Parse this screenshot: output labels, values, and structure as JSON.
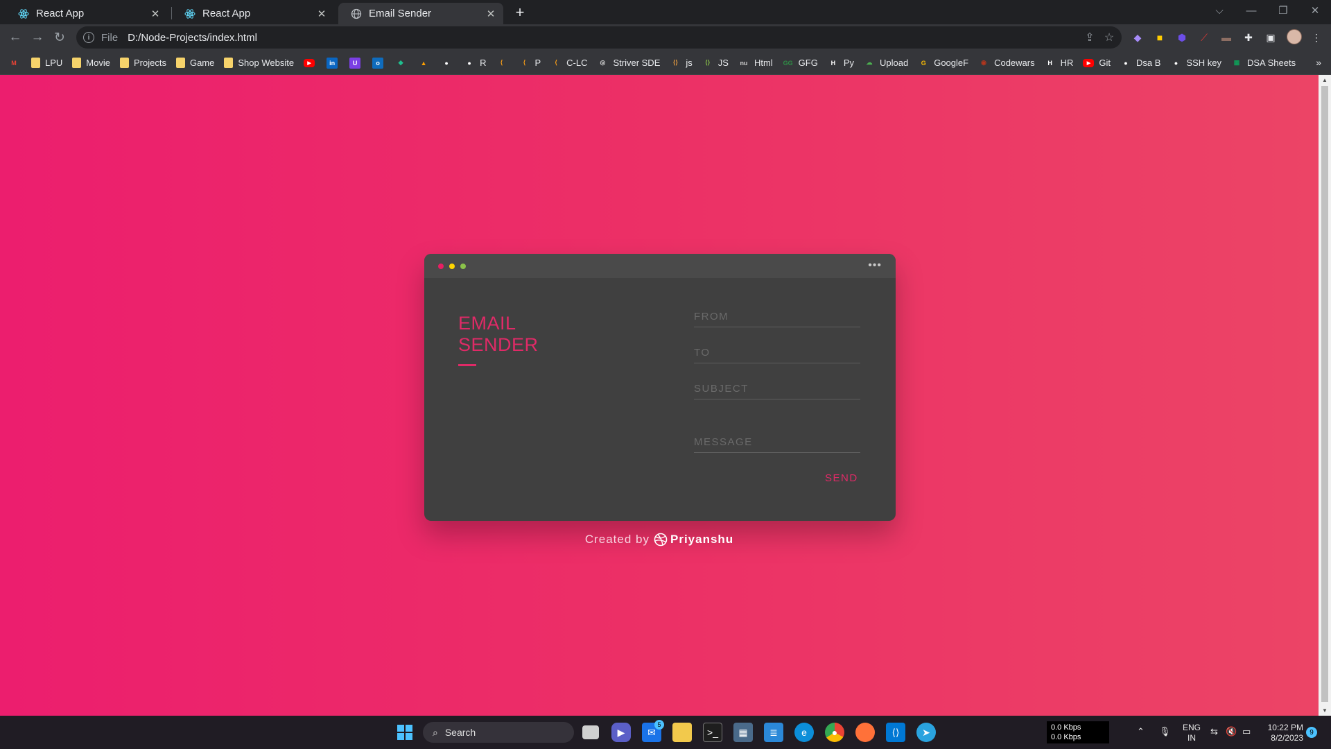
{
  "browser": {
    "tabs": [
      {
        "title": "React App",
        "active": false,
        "icon": "react-icon"
      },
      {
        "title": "React App",
        "active": false,
        "icon": "react-icon"
      },
      {
        "title": "Email Sender",
        "active": true,
        "icon": "globe-icon"
      }
    ],
    "address": {
      "scheme": "File",
      "url": "D:/Node-Projects/index.html"
    },
    "bookmarks": [
      {
        "label": "",
        "icon": "gmail-icon",
        "color": "#ea4335"
      },
      {
        "label": "LPU",
        "icon": "folder-icon",
        "color": "#f6d36b"
      },
      {
        "label": "Movie",
        "icon": "folder-icon",
        "color": "#f6d36b"
      },
      {
        "label": "Projects",
        "icon": "folder-icon",
        "color": "#f6d36b"
      },
      {
        "label": "Game",
        "icon": "folder-icon",
        "color": "#f6d36b"
      },
      {
        "label": "Shop Website",
        "icon": "folder-icon",
        "color": "#f6d36b"
      },
      {
        "label": "",
        "icon": "youtube-icon",
        "color": "#ff0000"
      },
      {
        "label": "",
        "icon": "linkedin-icon",
        "color": "#0a66c2"
      },
      {
        "label": "",
        "icon": "purple-app-icon",
        "color": "#7b3fe4"
      },
      {
        "label": "",
        "icon": "outlook-icon",
        "color": "#0f6cbd"
      },
      {
        "label": "",
        "icon": "diamond-icon",
        "color": "#1fbf8f"
      },
      {
        "label": "",
        "icon": "firebase-icon",
        "color": "#ffa000"
      },
      {
        "label": "",
        "icon": "github-icon",
        "color": "#ffffff"
      },
      {
        "label": "R",
        "icon": "github-icon",
        "color": "#ffffff"
      },
      {
        "label": "",
        "icon": "leetcode-icon",
        "color": "#ffa116"
      },
      {
        "label": "P",
        "icon": "leetcode-icon",
        "color": "#ffa116"
      },
      {
        "label": "C-LC",
        "icon": "leetcode-icon",
        "color": "#ffa116"
      },
      {
        "label": "Striver SDE",
        "icon": "globe-icon",
        "color": "#cfcfcf"
      },
      {
        "label": "js",
        "icon": "code-icon",
        "color": "#f7a541"
      },
      {
        "label": "JS",
        "icon": "code-icon",
        "color": "#8bc34a"
      },
      {
        "label": "Html",
        "icon": "nu-icon",
        "color": "#cfcfcf"
      },
      {
        "label": "GFG",
        "icon": "gfg-icon",
        "color": "#2f8d46"
      },
      {
        "label": "Py",
        "icon": "hr-icon",
        "color": "#ffffff"
      },
      {
        "label": "Upload",
        "icon": "cloud-icon",
        "color": "#4caf50"
      },
      {
        "label": "GoogleF",
        "icon": "google-icon",
        "color": "#fbbc04"
      },
      {
        "label": "Codewars",
        "icon": "codewars-icon",
        "color": "#b1361e"
      },
      {
        "label": "HR",
        "icon": "hr-icon",
        "color": "#ffffff"
      },
      {
        "label": "Git",
        "icon": "youtube-icon",
        "color": "#ff0000"
      },
      {
        "label": "Dsa B",
        "icon": "github-icon",
        "color": "#ffffff"
      },
      {
        "label": "SSH key",
        "icon": "github-icon",
        "color": "#ffffff"
      },
      {
        "label": "DSA Sheets",
        "icon": "sheets-icon",
        "color": "#0f9d58"
      }
    ]
  },
  "card": {
    "title_line1": "EMAIL",
    "title_line2": "SENDER",
    "fields": {
      "from": "FROM",
      "to": "TO",
      "subject": "SUBJECT",
      "message": "MESSAGE"
    },
    "send_label": "SEND",
    "dots": [
      "#e91e63",
      "#ffd600",
      "#8bc34a"
    ],
    "accent": "#e02a67"
  },
  "credit": {
    "prefix": "Created by",
    "name": "Priyanshu"
  },
  "taskbar": {
    "search_label": "Search",
    "mail_badge": "5",
    "net_down": "0.0 Kbps",
    "net_up": "0.0 Kbps",
    "lang_line1": "ENG",
    "lang_line2": "IN",
    "time": "10:22 PM",
    "date": "8/2/2023",
    "notifications": "9"
  },
  "colors": {
    "page_gradient_start": "#ec1e6e",
    "page_gradient_end": "#ec4466",
    "card_bg": "#404040"
  }
}
